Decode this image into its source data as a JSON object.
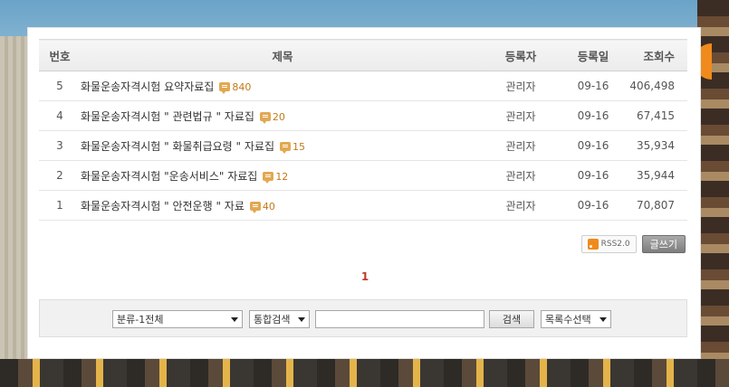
{
  "table": {
    "headers": {
      "no": "번호",
      "title": "제목",
      "author": "등록자",
      "date": "등록일",
      "views": "조회수"
    },
    "rows": [
      {
        "no": "5",
        "title": "화물운송자격시험 요약자료집",
        "comments": "840",
        "author": "관리자",
        "date": "09-16",
        "views": "406,498"
      },
      {
        "no": "4",
        "title": "화물운송자격시험 \" 관련법규 \" 자료집",
        "comments": "20",
        "author": "관리자",
        "date": "09-16",
        "views": "67,415"
      },
      {
        "no": "3",
        "title": "화물운송자격시험 \" 화물취급요령 \" 자료집",
        "comments": "15",
        "author": "관리자",
        "date": "09-16",
        "views": "35,934"
      },
      {
        "no": "2",
        "title": "화물운송자격시험 \"운송서비스\" 자료집",
        "comments": "12",
        "author": "관리자",
        "date": "09-16",
        "views": "35,944"
      },
      {
        "no": "1",
        "title": "화물운송자격시험 \" 안전운행 \" 자료",
        "comments": "40",
        "author": "관리자",
        "date": "09-16",
        "views": "70,807"
      }
    ]
  },
  "actions": {
    "rss_label": "RSS2.0",
    "write_label": "글쓰기"
  },
  "pagination": {
    "current": "1"
  },
  "search": {
    "category_selected": "분류-1전체",
    "scope_selected": "통합검색",
    "query_value": "",
    "search_label": "검색",
    "list_count_selected": "목록수선택"
  },
  "icons": {
    "comment": "comment-bubble-icon",
    "rss": "rss-icon",
    "dropdown": "chevron-down-icon"
  },
  "colors": {
    "accent": "#c07a1a",
    "page_active": "#c0392b"
  }
}
